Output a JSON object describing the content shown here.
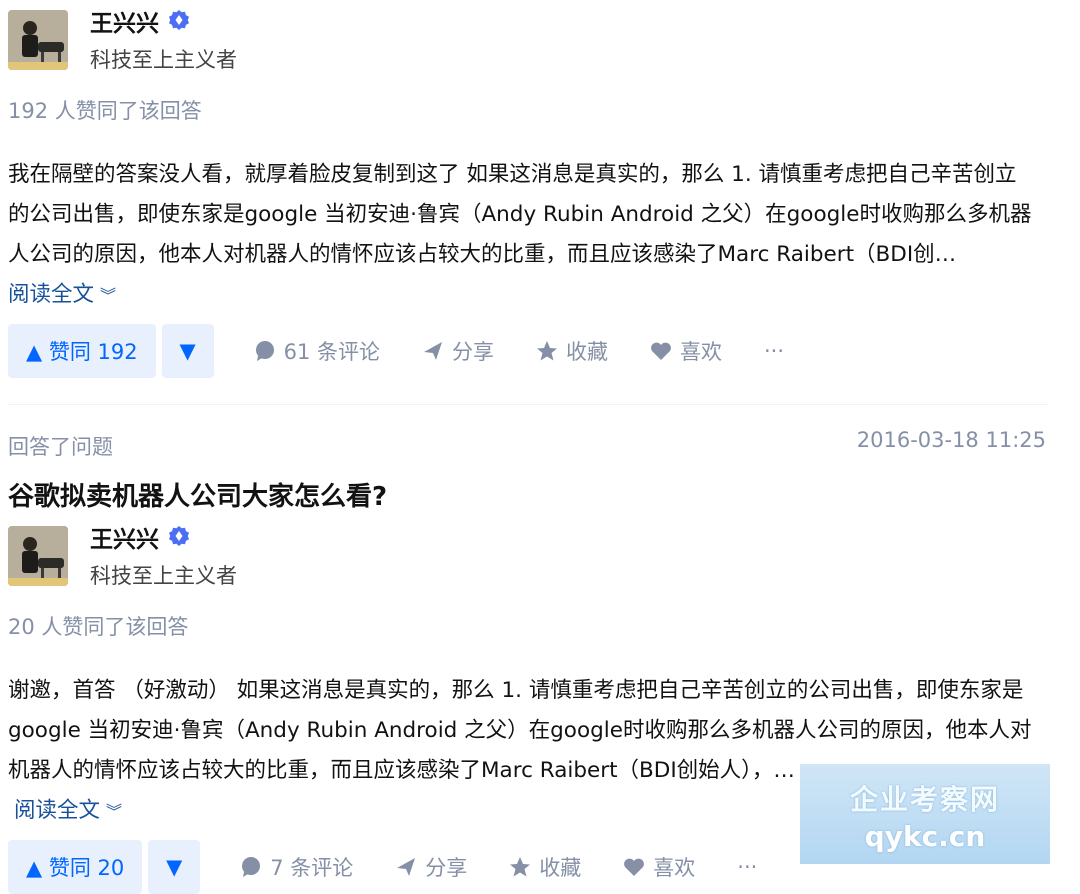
{
  "answers": [
    {
      "author": {
        "name": "王兴兴",
        "headline": "科技至上主义者"
      },
      "votes_text": "192 人赞同了该回答",
      "content": "我在隔壁的答案没人看，就厚着脸皮复制到这了 如果这消息是真实的，那么 1. 请慎重考虑把自己辛苦创立的公司出售，即使东家是google 当初安迪·鲁宾（Andy Rubin Android 之父）在google时收购那么多机器人公司的原因，他本人对机器人的情怀应该占较大的比重，而且应该感染了Marc Raibert（BDI创…",
      "read_more": "阅读全文",
      "vote_up_label": "▲ 赞同 192",
      "vote_down_label": "▼",
      "comments_label": "61 条评论",
      "share_label": "分享",
      "collect_label": "收藏",
      "like_label": "喜欢",
      "more_label": "···"
    },
    {
      "meta_label": "回答了问题",
      "timestamp": "2016-03-18 11:25",
      "question_title": "谷歌拟卖机器人公司大家怎么看?",
      "author": {
        "name": "王兴兴",
        "headline": "科技至上主义者"
      },
      "votes_text": "20 人赞同了该回答",
      "content": "谢邀，首答 （好激动） 如果这消息是真实的，那么 1. 请慎重考虑把自己辛苦创立的公司出售，即使东家是google 当初安迪·鲁宾（Andy Rubin Android 之父）在google时收购那么多机器人公司的原因，他本人对机器人的情怀应该占较大的比重，而且应该感染了Marc Raibert（BDI创始人），…",
      "read_more": "阅读全文",
      "vote_up_label": "▲ 赞同 20",
      "vote_down_label": "▼",
      "comments_label": "7 条评论",
      "share_label": "分享",
      "collect_label": "收藏",
      "like_label": "喜欢",
      "more_label": "···"
    }
  ],
  "watermark": {
    "title": "企业考察网",
    "url": "qykc.cn"
  },
  "colors": {
    "accent": "#0066ff",
    "vote_bg": "#e8f0fd",
    "muted": "#8590a6",
    "link": "#175199"
  }
}
